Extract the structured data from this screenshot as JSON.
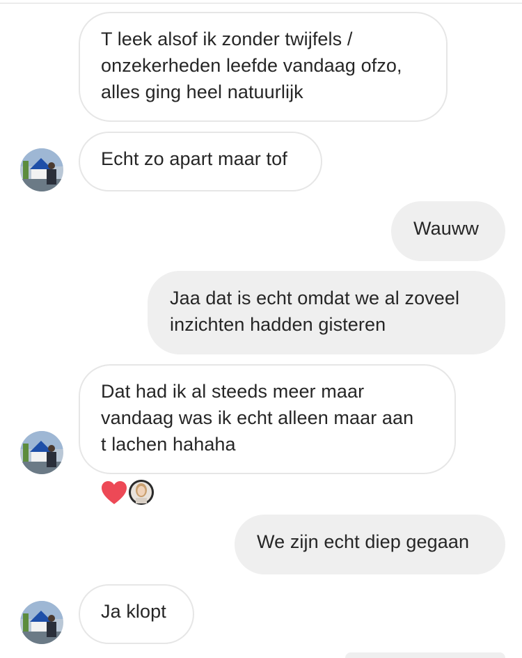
{
  "conversation": {
    "messages": [
      {
        "id": "m1",
        "direction": "incoming",
        "lines": [
          "T leek alsof ik zonder twijfels /",
          "onzekerheden leefde vandaag ofzo,",
          "alles ging heel natuurlijk"
        ]
      },
      {
        "id": "m2",
        "direction": "incoming",
        "lines": [
          "Echt zo apart maar tof"
        ]
      },
      {
        "id": "m3",
        "direction": "outgoing",
        "lines": [
          "Wauww"
        ]
      },
      {
        "id": "m4",
        "direction": "outgoing",
        "lines": [
          "Jaa dat is echt omdat we al zoveel",
          "inzichten hadden gisteren"
        ]
      },
      {
        "id": "m5",
        "direction": "incoming",
        "lines": [
          "Dat had ik al steeds meer maar",
          "vandaag was ik echt alleen maar aan",
          "t lachen hahaha"
        ],
        "reaction": {
          "emoji": "heart-icon",
          "color": "#ed4956"
        }
      },
      {
        "id": "m6",
        "direction": "outgoing",
        "lines": [
          "We zijn echt diep gegaan"
        ]
      },
      {
        "id": "m7",
        "direction": "incoming",
        "lines": [
          "Ja klopt"
        ]
      }
    ]
  },
  "colors": {
    "incoming_border": "#e6e6e6",
    "outgoing_bg": "#efefef",
    "text": "#262626",
    "heart": "#ed4956"
  }
}
